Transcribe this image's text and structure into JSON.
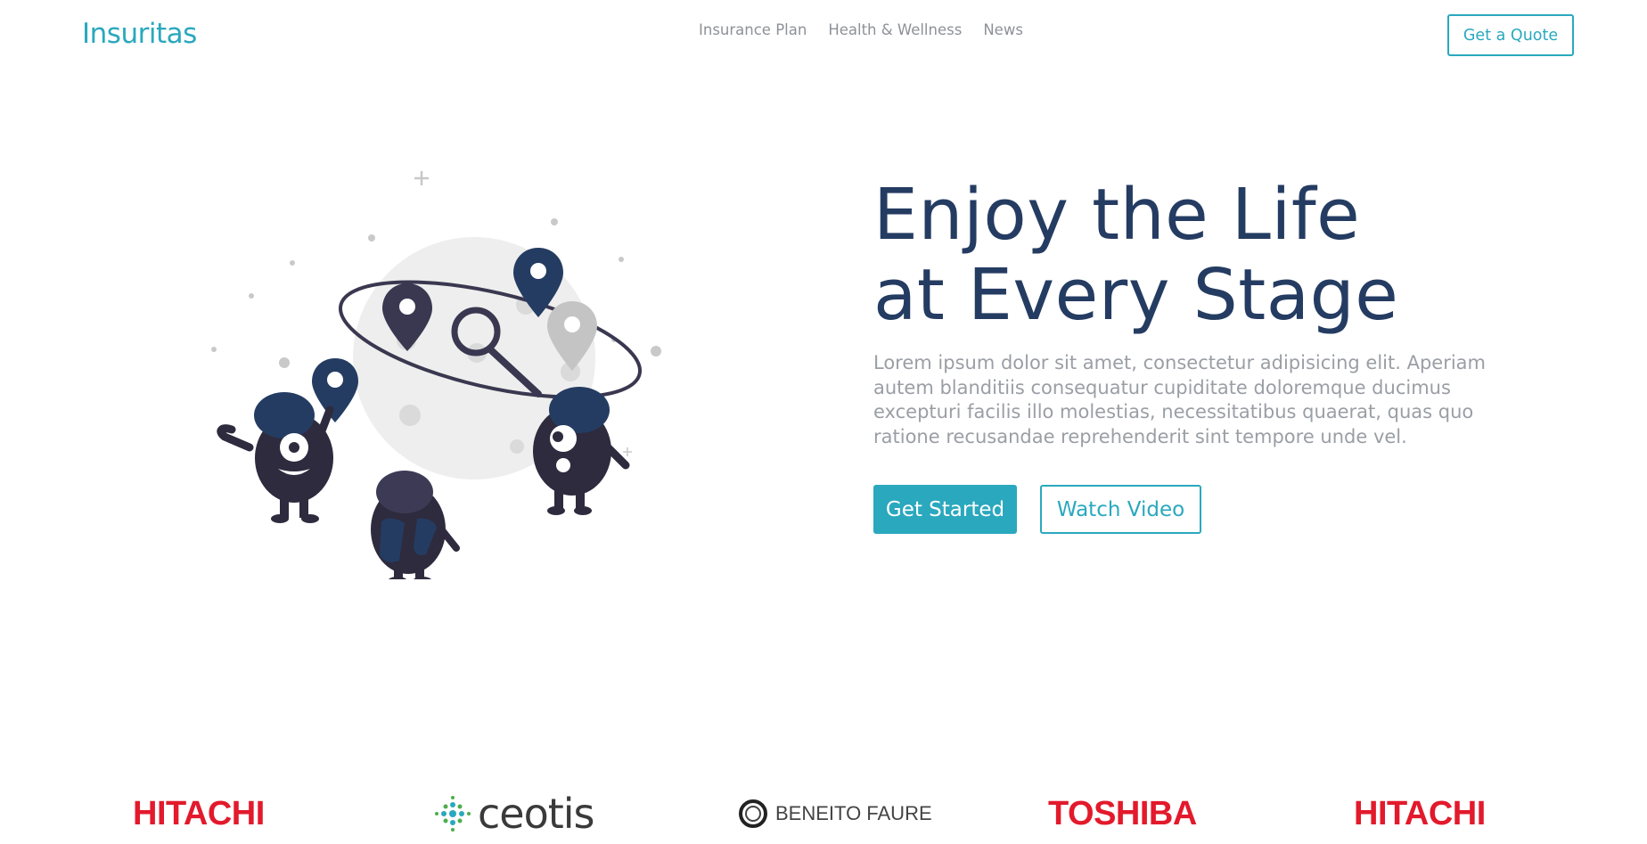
{
  "brand": {
    "name": "Insuritas",
    "color": "#2aa8be"
  },
  "nav": {
    "items": [
      "Insurance Plan",
      "Health & Wellness",
      "News"
    ],
    "quote_label": "Get a Quote"
  },
  "hero": {
    "title_line1": "Enjoy the Life",
    "title_line2": "at Every Stage",
    "description": "Lorem ipsum dolor sit amet, consectetur adipisicing elit. Aperiam autem blanditiis consequatur cupiditate doloremque ducimus excepturi facilis illo molestias, necessitatibus quaerat, quas quo ratione recusandae reprehenderit sint tempore unde vel.",
    "primary_button": "Get Started",
    "secondary_button": "Watch Video",
    "illustration": "monsters-exploring-map-planet"
  },
  "clients": [
    "HITACHI",
    "ceotis",
    "BENEITO FAURE",
    "TOSHIBA",
    "HITACHI"
  ],
  "colors": {
    "accent": "#2aa8be",
    "heading": "#253c62",
    "body_text": "#9a9ea5",
    "logo_red": "#e21a2c"
  }
}
